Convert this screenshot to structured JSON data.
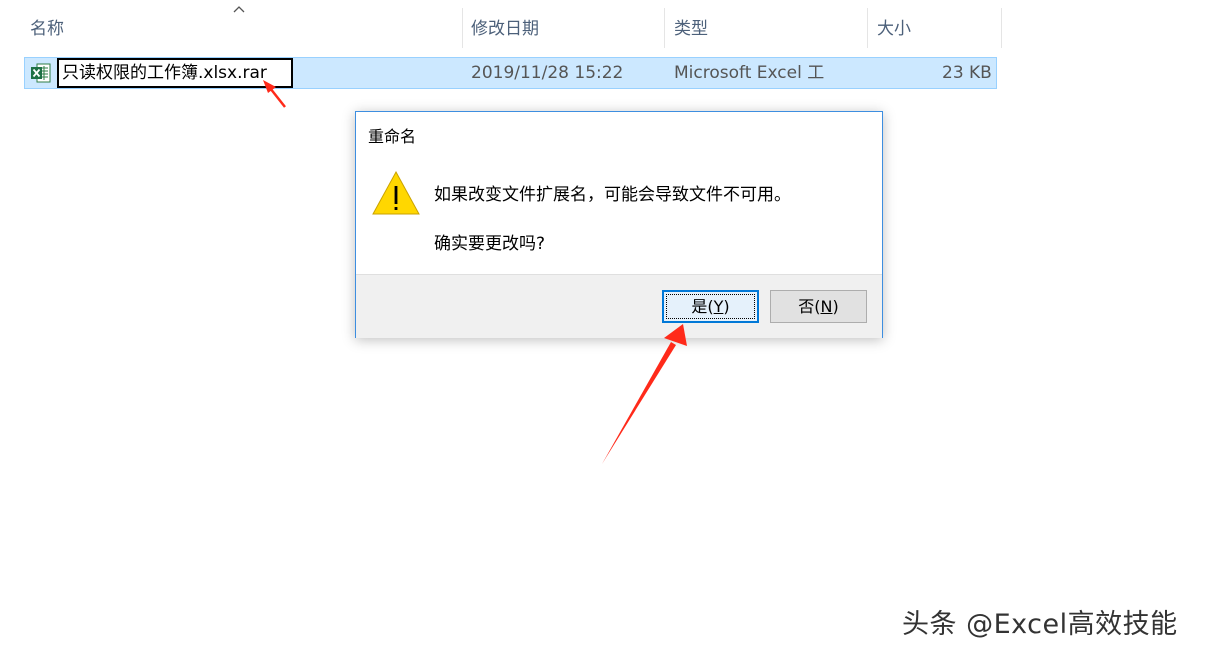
{
  "columns": {
    "name": "名称",
    "modified": "修改日期",
    "type": "类型",
    "size": "大小"
  },
  "file": {
    "name_editing": "只读权限的工作簿.xlsx.rar",
    "modified": "2019/11/28 15:22",
    "type": "Microsoft Excel 工",
    "size": "23 KB",
    "icon": "excel-file-icon"
  },
  "dialog": {
    "title": "重命名",
    "message_line1": "如果改变文件扩展名，可能会导致文件不可用。",
    "message_line2": "确实要更改吗?",
    "icon": "warning-icon",
    "yes_prefix": "是(",
    "yes_key": "Y",
    "yes_suffix": ")",
    "no_prefix": "否(",
    "no_key": "N",
    "no_suffix": ")"
  },
  "watermark": "头条 @Excel高效技能",
  "colors": {
    "selection": "#cce8ff",
    "dialog_border": "#3d8ee0",
    "default_button_border": "#0078d7",
    "annotation_arrow": "#ff2a1a",
    "warning_yellow": "#ffd700"
  }
}
